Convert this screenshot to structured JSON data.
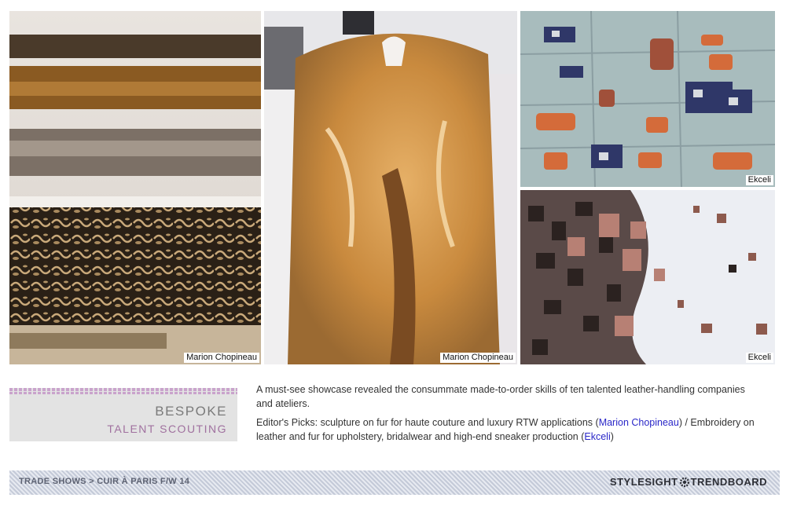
{
  "photos": [
    {
      "credit": "Marion Chopineau",
      "subject": "fur-pelts-closeup"
    },
    {
      "credit": "Marion Chopineau",
      "subject": "fox-fur-vest"
    },
    {
      "credit": "Ekceli",
      "subject": "leather-embroidery-grid"
    },
    {
      "credit": "Ekceli",
      "subject": "leather-sequin-embroidery"
    }
  ],
  "tag": {
    "title": "BESPOKE",
    "subtitle": "TALENT SCOUTING"
  },
  "description": {
    "paragraph1": "A must-see showcase revealed the consummate made-to-order skills of ten talented leather-handling companies and ateliers.",
    "p2_part1": "Editor's Picks: sculpture on fur for haute couture and luxury RTW applications (",
    "p2_link1": "Marion Chopineau",
    "p2_part2": ") / Embroidery on leather and fur for upholstery, bridalwear and high-end sneaker production (",
    "p2_link2": "Ekceli",
    "p2_part3": ")"
  },
  "footer": {
    "breadcrumb": "TRADE SHOWS > CUIR À PARIS F/W 14",
    "brand_left": "STYLESIGHT",
    "brand_right": "TRENDBOARD"
  },
  "colors": {
    "accent": "#a0719f",
    "link": "#2a27c8",
    "footer_stripe": "#c4cad8"
  },
  "icons": [
    "gear-icon"
  ]
}
